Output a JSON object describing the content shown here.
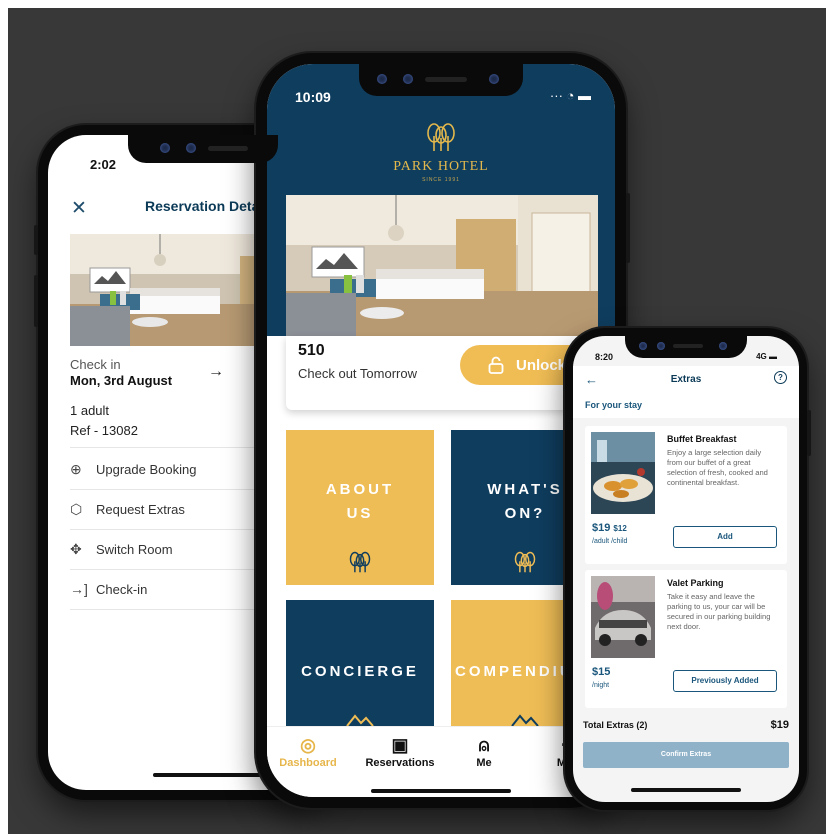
{
  "left_screen": {
    "status_time": "2:02",
    "title": "Reservation Details",
    "close_icon": "close-icon",
    "check_in_label": "Check in",
    "check_in_date": "Mon, 3rd August",
    "guests": "1 adult",
    "ref": "Ref - 13082",
    "menu": [
      {
        "label": "Upgrade Booking",
        "icon": "upgrade-icon"
      },
      {
        "label": "Request Extras",
        "icon": "gift-icon"
      },
      {
        "label": "Switch Room",
        "icon": "move-icon"
      },
      {
        "label": "Check-in",
        "icon": "enter-icon"
      }
    ]
  },
  "center_screen": {
    "status_time": "10:09",
    "hotel_name": "PARK HOTEL",
    "hotel_since": "SINCE 1991",
    "room_number": "510",
    "checkout_text": "Check out Tomorrow",
    "unlock_label": "Unlock",
    "tiles": [
      {
        "label": "ABOUT US",
        "line1": "ABOUT",
        "line2": "US",
        "color": "#efbd56"
      },
      {
        "label": "WHAT'S ON?",
        "line1": "WHAT'S",
        "line2": "ON?",
        "color": "#0f3d5e"
      },
      {
        "label": "CONCIERGE",
        "line1": "CONCIERGE",
        "line2": "",
        "color": "#0f3d5e"
      },
      {
        "label": "COMPENDIUM",
        "line1": "COMPENDIU",
        "line2": "",
        "color": "#efbd56"
      }
    ],
    "tabs": [
      {
        "label": "Dashboard",
        "icon": "compass-icon",
        "active": true
      },
      {
        "label": "Reservations",
        "icon": "calendar-icon",
        "active": false
      },
      {
        "label": "Me",
        "icon": "person-icon",
        "active": false
      },
      {
        "label": "More",
        "icon": "more-icon",
        "active": false
      }
    ]
  },
  "right_screen": {
    "status_time": "8:20",
    "status_signal": "4G",
    "title": "Extras",
    "subtitle": "For your stay",
    "items": [
      {
        "name": "Buffet Breakfast",
        "description": "Enjoy a large selection daily from our buffet of a great selection of fresh, cooked and continental breakfast.",
        "price": "$19",
        "price2": "$12",
        "unit": "/adult",
        "unit2": "/child",
        "button": "Add"
      },
      {
        "name": "Valet Parking",
        "description": "Take it easy and leave the parking to us, your car will be secured in our parking building next door.",
        "price": "$15",
        "price2": "",
        "unit": "/night",
        "unit2": "",
        "button": "Previously Added"
      }
    ],
    "total_label": "Total Extras (2)",
    "total_amount": "$19",
    "confirm_label": "Confirm Extras"
  },
  "colors": {
    "navy": "#0f3d5e",
    "gold": "#efbd56",
    "accent_blue": "#1a567b",
    "background": "#383838"
  }
}
